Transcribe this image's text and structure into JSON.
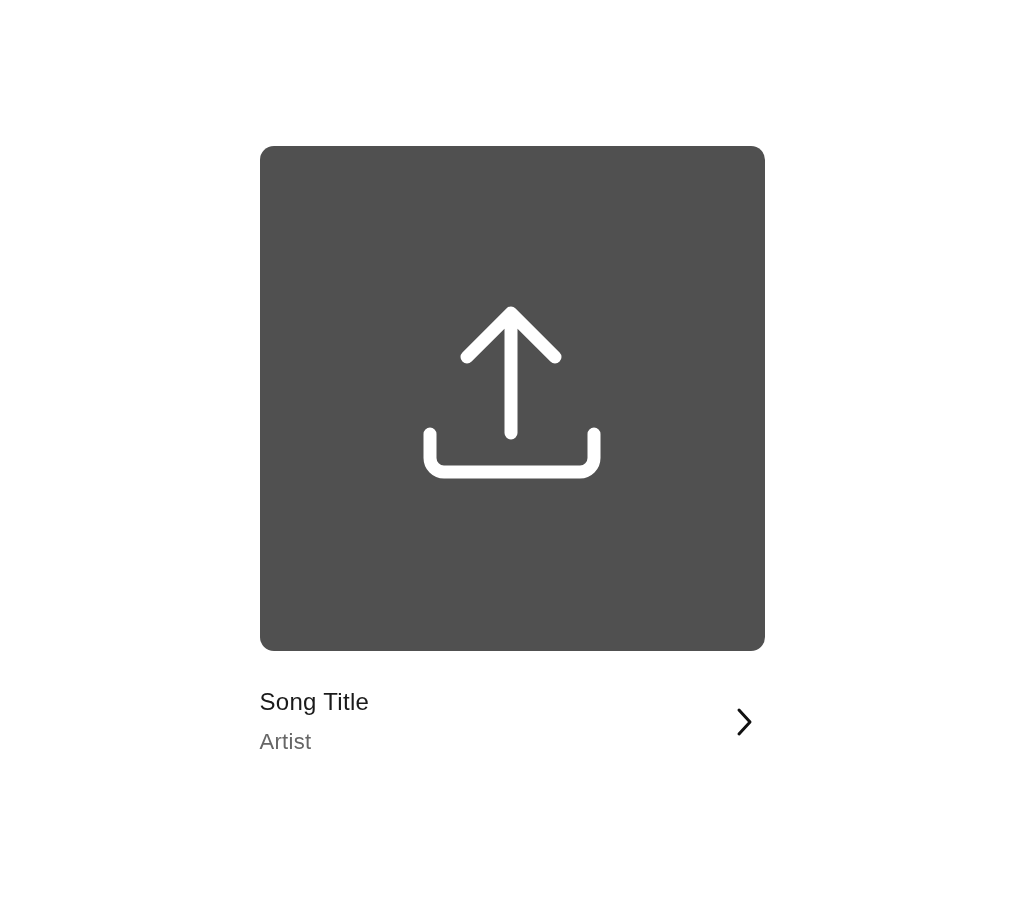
{
  "song": {
    "title": "Song Title",
    "artist": "Artist"
  }
}
